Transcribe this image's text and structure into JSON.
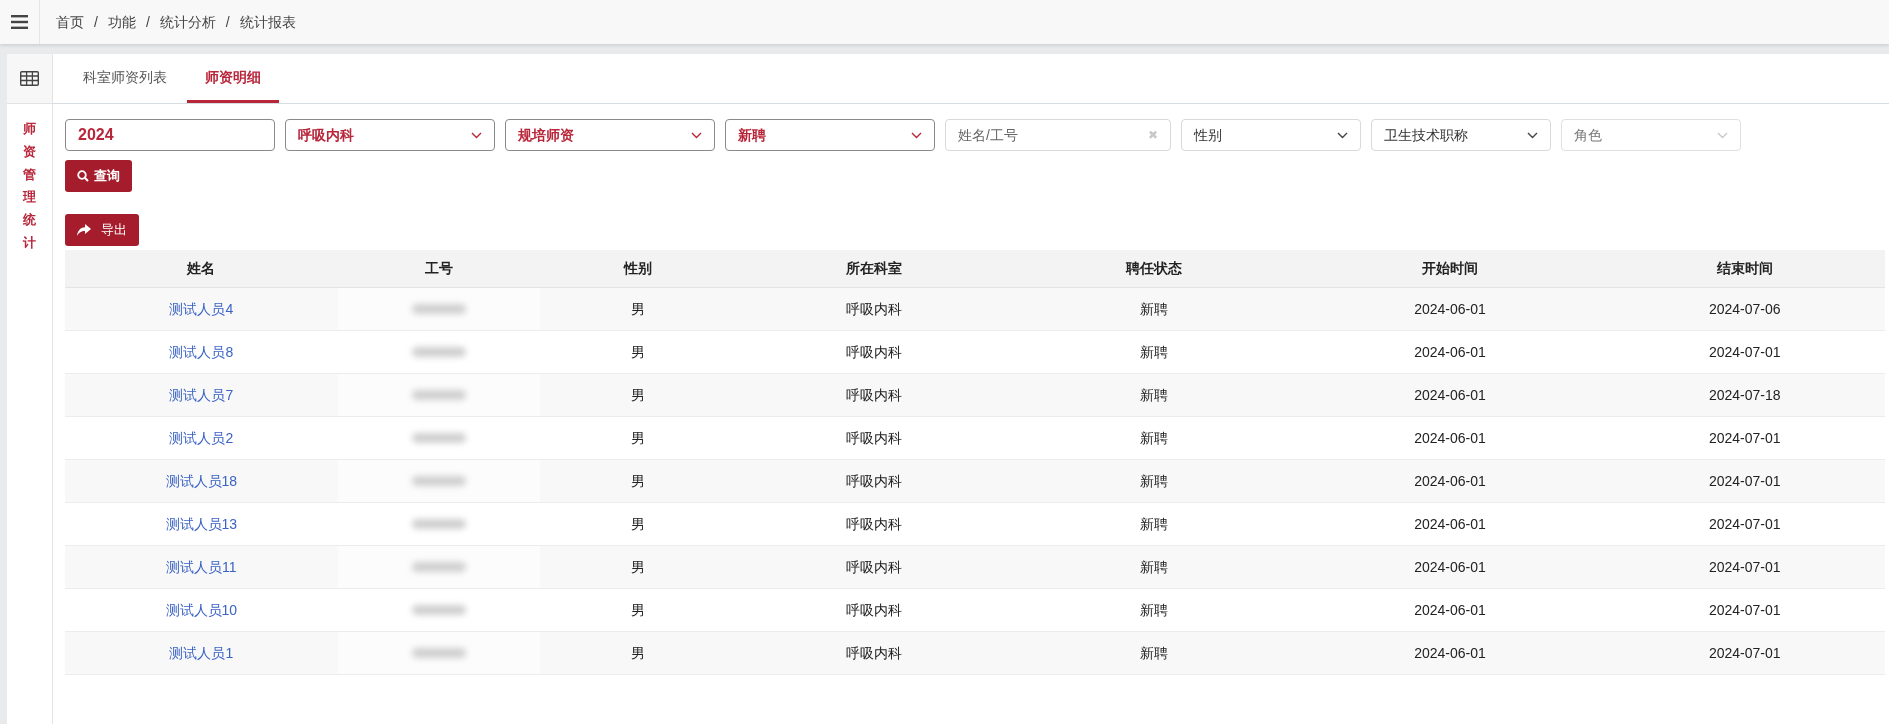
{
  "breadcrumb": [
    "首页",
    "功能",
    "统计分析",
    "统计报表"
  ],
  "breadcrumb_separator": "/",
  "side_label": "师资管理统计",
  "tabs": [
    {
      "label": "科室师资列表",
      "selected": false
    },
    {
      "label": "师资明细",
      "selected": true
    }
  ],
  "filters": [
    {
      "kind": "input",
      "value": "2024"
    },
    {
      "kind": "select",
      "value": "呼吸内科",
      "disabled": false
    },
    {
      "kind": "select",
      "value": "规培师资",
      "disabled": false
    },
    {
      "kind": "select",
      "value": "新聘",
      "disabled": false
    },
    {
      "kind": "search",
      "placeholder": "姓名/工号",
      "clear": "✖"
    },
    {
      "kind": "select",
      "placeholder": "性别",
      "disabled": false
    },
    {
      "kind": "select",
      "placeholder": "卫生技术职称",
      "disabled": false
    },
    {
      "kind": "select",
      "placeholder": "角色",
      "disabled": true
    }
  ],
  "query_button": "查询",
  "export_button": "导出",
  "table": {
    "columns": [
      "姓名",
      "工号",
      "性别",
      "所在科室",
      "聘任状态",
      "开始时间",
      "结束时间"
    ],
    "rows": [
      {
        "name": "测试人员4",
        "gender": "男",
        "department": "呼吸内科",
        "status": "新聘",
        "start": "2024-06-01",
        "end": "2024-07-06"
      },
      {
        "name": "测试人员8",
        "gender": "男",
        "department": "呼吸内科",
        "status": "新聘",
        "start": "2024-06-01",
        "end": "2024-07-01"
      },
      {
        "name": "测试人员7",
        "gender": "男",
        "department": "呼吸内科",
        "status": "新聘",
        "start": "2024-06-01",
        "end": "2024-07-18"
      },
      {
        "name": "测试人员2",
        "gender": "男",
        "department": "呼吸内科",
        "status": "新聘",
        "start": "2024-06-01",
        "end": "2024-07-01"
      },
      {
        "name": "测试人员18",
        "gender": "男",
        "department": "呼吸内科",
        "status": "新聘",
        "start": "2024-06-01",
        "end": "2024-07-01"
      },
      {
        "name": "测试人员13",
        "gender": "男",
        "department": "呼吸内科",
        "status": "新聘",
        "start": "2024-06-01",
        "end": "2024-07-01"
      },
      {
        "name": "测试人员11",
        "gender": "男",
        "department": "呼吸内科",
        "status": "新聘",
        "start": "2024-06-01",
        "end": "2024-07-01"
      },
      {
        "name": "测试人员10",
        "gender": "男",
        "department": "呼吸内科",
        "status": "新聘",
        "start": "2024-06-01",
        "end": "2024-07-01"
      },
      {
        "name": "测试人员1",
        "gender": "男",
        "department": "呼吸内科",
        "status": "新聘",
        "start": "2024-06-01",
        "end": "2024-07-01"
      }
    ]
  }
}
